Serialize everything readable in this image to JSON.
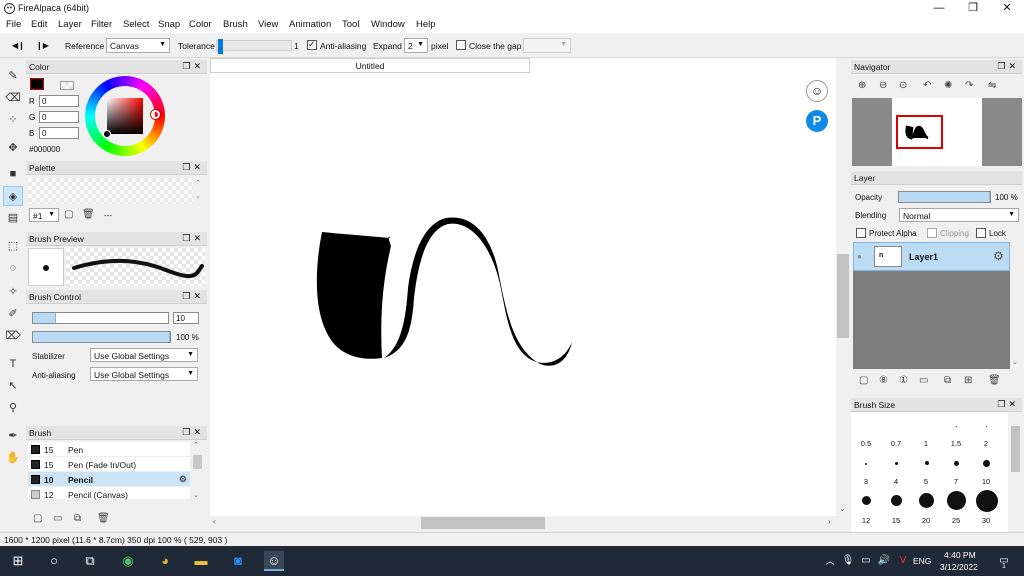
{
  "window": {
    "title": "FireAlpaca (64bit)",
    "controls": [
      "—",
      "❐",
      "✕"
    ]
  },
  "menu": [
    "File",
    "Edit",
    "Layer",
    "Filter",
    "Select",
    "Snap",
    "Color",
    "Brush",
    "View",
    "Animation",
    "Tool",
    "Window",
    "Help"
  ],
  "toolbar": {
    "prev_icon": "◀❙",
    "next_icon": "❙▶",
    "reference_label": "Reference",
    "reference_value": "Canvas",
    "tolerance_label": "Tolerance",
    "tolerance_value": "1",
    "antialiasing_label": "Anti-aliasing",
    "antialiasing_checked": true,
    "expand_label": "Expand",
    "expand_value": "2",
    "expand_unit": "pixel",
    "close_gap_label": "Close the gap",
    "close_gap_checked": false
  },
  "tools": [
    "pen-icon",
    "eraser-icon",
    "dot-icon",
    "move-icon",
    "fill-rect-icon",
    "bucket-icon",
    "gradient-icon",
    "select-rect-icon",
    "lasso-icon",
    "magic-wand-icon",
    "select-pen-icon",
    "select-eraser-icon",
    "text-icon",
    "operation-icon",
    "dropper-icon",
    "eyedropper-icon",
    "hand-icon"
  ],
  "color_panel": {
    "title": "Color",
    "r": "0",
    "g": "0",
    "b": "0",
    "hex": "#000000",
    "r_label": "R",
    "g_label": "G",
    "b_label": "B"
  },
  "palette_panel": {
    "title": "Palette",
    "selector": "#1",
    "dash": "---"
  },
  "brush_preview_panel": {
    "title": "Brush Preview"
  },
  "brush_control_panel": {
    "title": "Brush Control",
    "size_value": "10",
    "size_fraction": 0.17,
    "opacity_value": "100",
    "opacity_unit": "%",
    "opacity_fraction": 1.0,
    "stabilizer_label": "Stabilizer",
    "stabilizer_value": "Use Global Settings",
    "antialiasing_label": "Anti-aliasing",
    "antialiasing_value": "Use Global Settings"
  },
  "brush_panel": {
    "title": "Brush",
    "items": [
      {
        "size": "15",
        "name": "Pen"
      },
      {
        "size": "15",
        "name": "Pen (Fade In/Out)"
      },
      {
        "size": "10",
        "name": "Pencil"
      },
      {
        "size": "12",
        "name": "Pencil (Canvas)"
      }
    ],
    "selected_index": 2
  },
  "canvas": {
    "tab_title": "Untitled"
  },
  "navigator_panel": {
    "title": "Navigator"
  },
  "layer_panel": {
    "title": "Layer",
    "opacity_label": "Opacity",
    "opacity_value": "100",
    "opacity_unit": "%",
    "opacity_fraction": 1.0,
    "blending_label": "Blending",
    "blending_value": "Normal",
    "protect_alpha_label": "Protect Alpha",
    "clipping_label": "Clipping",
    "lock_label": "Lock",
    "layers": [
      {
        "name": "Layer1"
      }
    ]
  },
  "brush_size_panel": {
    "title": "Brush Size",
    "rows": [
      [
        "0.5",
        "0.7",
        "1",
        "1.5",
        "2"
      ],
      [
        "3",
        "4",
        "5",
        "7",
        "10"
      ],
      [
        "12",
        "15",
        "20",
        "25",
        "30"
      ]
    ]
  },
  "status": {
    "text": "1600 * 1200 pixel  (11.6 * 8.7cm)  350 dpi  100 %  ( 529, 903 )"
  },
  "taskbar": {
    "time": "4:40 PM",
    "date": "3/12/2022",
    "lang": "ENG",
    "notification_count": "1"
  },
  "colors": {
    "accent": "#0078d7",
    "selection": "#cce4f7",
    "layer_bg": "#bcdcf4",
    "taskbar": "#1f2a36"
  }
}
